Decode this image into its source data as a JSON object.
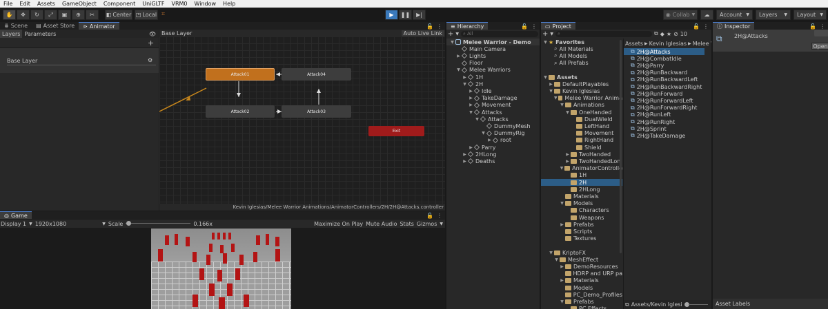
{
  "menu": [
    "File",
    "Edit",
    "Assets",
    "GameObject",
    "Component",
    "UniGLTF",
    "VRM0",
    "Window",
    "Help"
  ],
  "toolbar": {
    "pivot": "Center",
    "space": "Local",
    "collab": "Collab",
    "account": "Account",
    "layers": "Layers",
    "layout": "Layout"
  },
  "scene_tabs": [
    "Scene",
    "Asset Store",
    "Animator"
  ],
  "animator": {
    "sub_tabs": [
      "Layers",
      "Parameters"
    ],
    "breadcrumb": "Base Layer",
    "auto_live_link": "Auto Live Link",
    "layer_name": "Base Layer",
    "nodes": [
      "Attack01",
      "Attack04",
      "Attack02",
      "Attack03",
      "Exit"
    ],
    "footer_path": "Kevin Iglesias/Melee Warrior Animations/AnimatorControllers/2H/2H@Attacks.controller"
  },
  "game": {
    "tab": "Game",
    "display": "Display 1",
    "resolution": "1920x1080",
    "scale_label": "Scale",
    "scale_value": "0.166x",
    "maximize": "Maximize On Play",
    "mute": "Mute Audio",
    "stats": "Stats",
    "gizmos": "Gizmos"
  },
  "hierarchy": {
    "tab": "Hierarchy",
    "search_placeholder": "All",
    "rows": [
      {
        "label": "Melee Warrior - Demo",
        "depth": 0,
        "fold": "open",
        "kind": "scene"
      },
      {
        "label": "Main Camera",
        "depth": 1,
        "fold": "",
        "kind": "go"
      },
      {
        "label": "Lights",
        "depth": 1,
        "fold": "closed",
        "kind": "go"
      },
      {
        "label": "Floor",
        "depth": 1,
        "fold": "",
        "kind": "go"
      },
      {
        "label": "Melee Warriors",
        "depth": 1,
        "fold": "open",
        "kind": "go"
      },
      {
        "label": "1H",
        "depth": 2,
        "fold": "closed",
        "kind": "go"
      },
      {
        "label": "2H",
        "depth": 2,
        "fold": "open",
        "kind": "go"
      },
      {
        "label": "Idle",
        "depth": 3,
        "fold": "closed",
        "kind": "go"
      },
      {
        "label": "TakeDamage",
        "depth": 3,
        "fold": "closed",
        "kind": "go"
      },
      {
        "label": "Movement",
        "depth": 3,
        "fold": "closed",
        "kind": "go"
      },
      {
        "label": "Attacks",
        "depth": 3,
        "fold": "open",
        "kind": "go"
      },
      {
        "label": "Attacks",
        "depth": 4,
        "fold": "open",
        "kind": "go"
      },
      {
        "label": "DummyMesh",
        "depth": 5,
        "fold": "",
        "kind": "go"
      },
      {
        "label": "DummyRig",
        "depth": 5,
        "fold": "open",
        "kind": "go"
      },
      {
        "label": "root",
        "depth": 6,
        "fold": "closed",
        "kind": "go"
      },
      {
        "label": "Parry",
        "depth": 3,
        "fold": "closed",
        "kind": "go"
      },
      {
        "label": "2HLong",
        "depth": 2,
        "fold": "closed",
        "kind": "go"
      },
      {
        "label": "Deaths",
        "depth": 2,
        "fold": "closed",
        "kind": "go"
      }
    ]
  },
  "project": {
    "tab": "Project",
    "count": "10",
    "breadcrumb": [
      "Assets",
      "Kevin Iglesias",
      "Melee W"
    ],
    "tree": [
      {
        "label": "Favorites",
        "depth": 0,
        "fold": "open",
        "kind": "star"
      },
      {
        "label": "All Materials",
        "depth": 1,
        "fold": "",
        "kind": "search"
      },
      {
        "label": "All Models",
        "depth": 1,
        "fold": "",
        "kind": "search"
      },
      {
        "label": "All Prefabs",
        "depth": 1,
        "fold": "",
        "kind": "search"
      },
      {
        "label": "",
        "depth": 0,
        "fold": "",
        "kind": "blank"
      },
      {
        "label": "Assets",
        "depth": 0,
        "fold": "open",
        "kind": "folder"
      },
      {
        "label": "DefaultPlayables",
        "depth": 1,
        "fold": "closed",
        "kind": "folder"
      },
      {
        "label": "Kevin Iglesias",
        "depth": 1,
        "fold": "open",
        "kind": "folder"
      },
      {
        "label": "Melee Warrior Anima",
        "depth": 2,
        "fold": "open",
        "kind": "folder"
      },
      {
        "label": "Animations",
        "depth": 3,
        "fold": "open",
        "kind": "folder"
      },
      {
        "label": "OneHanded",
        "depth": 4,
        "fold": "open",
        "kind": "folder"
      },
      {
        "label": "DualWield",
        "depth": 5,
        "fold": "",
        "kind": "folder"
      },
      {
        "label": "LeftHand",
        "depth": 5,
        "fold": "",
        "kind": "folder"
      },
      {
        "label": "Movement",
        "depth": 5,
        "fold": "",
        "kind": "folder"
      },
      {
        "label": "RightHand",
        "depth": 5,
        "fold": "",
        "kind": "folder"
      },
      {
        "label": "Shield",
        "depth": 5,
        "fold": "",
        "kind": "folder"
      },
      {
        "label": "TwoHanded",
        "depth": 4,
        "fold": "closed",
        "kind": "folder"
      },
      {
        "label": "TwoHandedLon",
        "depth": 4,
        "fold": "closed",
        "kind": "folder"
      },
      {
        "label": "AnimatorControlle",
        "depth": 3,
        "fold": "open",
        "kind": "folder"
      },
      {
        "label": "1H",
        "depth": 4,
        "fold": "",
        "kind": "folder"
      },
      {
        "label": "2H",
        "depth": 4,
        "fold": "",
        "kind": "folder",
        "selected": true
      },
      {
        "label": "2HLong",
        "depth": 4,
        "fold": "",
        "kind": "folder"
      },
      {
        "label": "Materials",
        "depth": 3,
        "fold": "",
        "kind": "folder"
      },
      {
        "label": "Models",
        "depth": 3,
        "fold": "open",
        "kind": "folder"
      },
      {
        "label": "Characters",
        "depth": 4,
        "fold": "",
        "kind": "folder"
      },
      {
        "label": "Weapons",
        "depth": 4,
        "fold": "",
        "kind": "folder"
      },
      {
        "label": "Prefabs",
        "depth": 3,
        "fold": "closed",
        "kind": "folder"
      },
      {
        "label": "Scripts",
        "depth": 3,
        "fold": "",
        "kind": "folder"
      },
      {
        "label": "Textures",
        "depth": 3,
        "fold": "",
        "kind": "folder"
      },
      {
        "label": "",
        "depth": 0,
        "fold": "",
        "kind": "blank"
      },
      {
        "label": "KriptoFX",
        "depth": 1,
        "fold": "open",
        "kind": "folder"
      },
      {
        "label": "MeshEffect",
        "depth": 2,
        "fold": "open",
        "kind": "folder"
      },
      {
        "label": "DemoResources",
        "depth": 3,
        "fold": "closed",
        "kind": "folder"
      },
      {
        "label": "HDRP and URP pa",
        "depth": 3,
        "fold": "",
        "kind": "folder"
      },
      {
        "label": "Materials",
        "depth": 3,
        "fold": "closed",
        "kind": "folder"
      },
      {
        "label": "Models",
        "depth": 3,
        "fold": "",
        "kind": "folder"
      },
      {
        "label": "PC_Demo_Profiles",
        "depth": 3,
        "fold": "",
        "kind": "folder"
      },
      {
        "label": "Prefabs",
        "depth": 3,
        "fold": "open",
        "kind": "folder"
      },
      {
        "label": "PC Effects",
        "depth": 4,
        "fold": "",
        "kind": "folder"
      }
    ],
    "files": [
      {
        "label": "2H@Attacks",
        "selected": true
      },
      {
        "label": "2H@CombatIdle"
      },
      {
        "label": "2H@Parry"
      },
      {
        "label": "2H@RunBackward"
      },
      {
        "label": "2H@RunBackwardLeft"
      },
      {
        "label": "2H@RunBackwardRight"
      },
      {
        "label": "2H@RunForward"
      },
      {
        "label": "2H@RunForwardLeft"
      },
      {
        "label": "2H@RunForwardRight"
      },
      {
        "label": "2H@RunLeft"
      },
      {
        "label": "2H@RunRight"
      },
      {
        "label": "2H@Sprint"
      },
      {
        "label": "2H@TakeDamage"
      }
    ],
    "footer_path": "Assets/Kevin Iglesi"
  },
  "inspector": {
    "tab": "Inspector",
    "title": "2H@Attacks",
    "open_button": "Open",
    "asset_labels": "Asset Labels"
  }
}
